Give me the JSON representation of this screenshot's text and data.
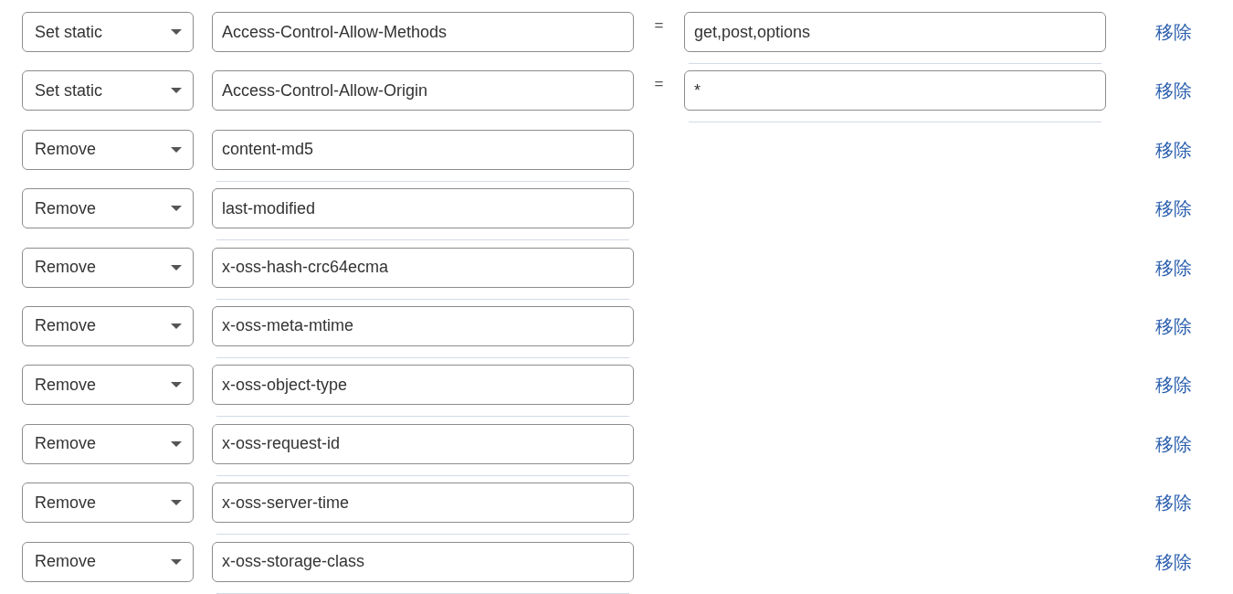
{
  "rows": [
    {
      "kind": "set",
      "action": "Set static",
      "name": "Access-Control-Allow-Methods",
      "equals": "=",
      "value": "get,post,options",
      "remove": "移除"
    },
    {
      "kind": "set",
      "action": "Set static",
      "name": "Access-Control-Allow-Origin",
      "equals": "=",
      "value": "*",
      "remove": "移除"
    },
    {
      "kind": "remove",
      "action": "Remove",
      "name": "content-md5",
      "remove": "移除"
    },
    {
      "kind": "remove",
      "action": "Remove",
      "name": "last-modified",
      "remove": "移除"
    },
    {
      "kind": "remove",
      "action": "Remove",
      "name": "x-oss-hash-crc64ecma",
      "remove": "移除"
    },
    {
      "kind": "remove",
      "action": "Remove",
      "name": "x-oss-meta-mtime",
      "remove": "移除"
    },
    {
      "kind": "remove",
      "action": "Remove",
      "name": "x-oss-object-type",
      "remove": "移除"
    },
    {
      "kind": "remove",
      "action": "Remove",
      "name": "x-oss-request-id",
      "remove": "移除"
    },
    {
      "kind": "remove",
      "action": "Remove",
      "name": "x-oss-server-time",
      "remove": "移除"
    },
    {
      "kind": "remove",
      "action": "Remove",
      "name": "x-oss-storage-class",
      "remove": "移除"
    }
  ]
}
